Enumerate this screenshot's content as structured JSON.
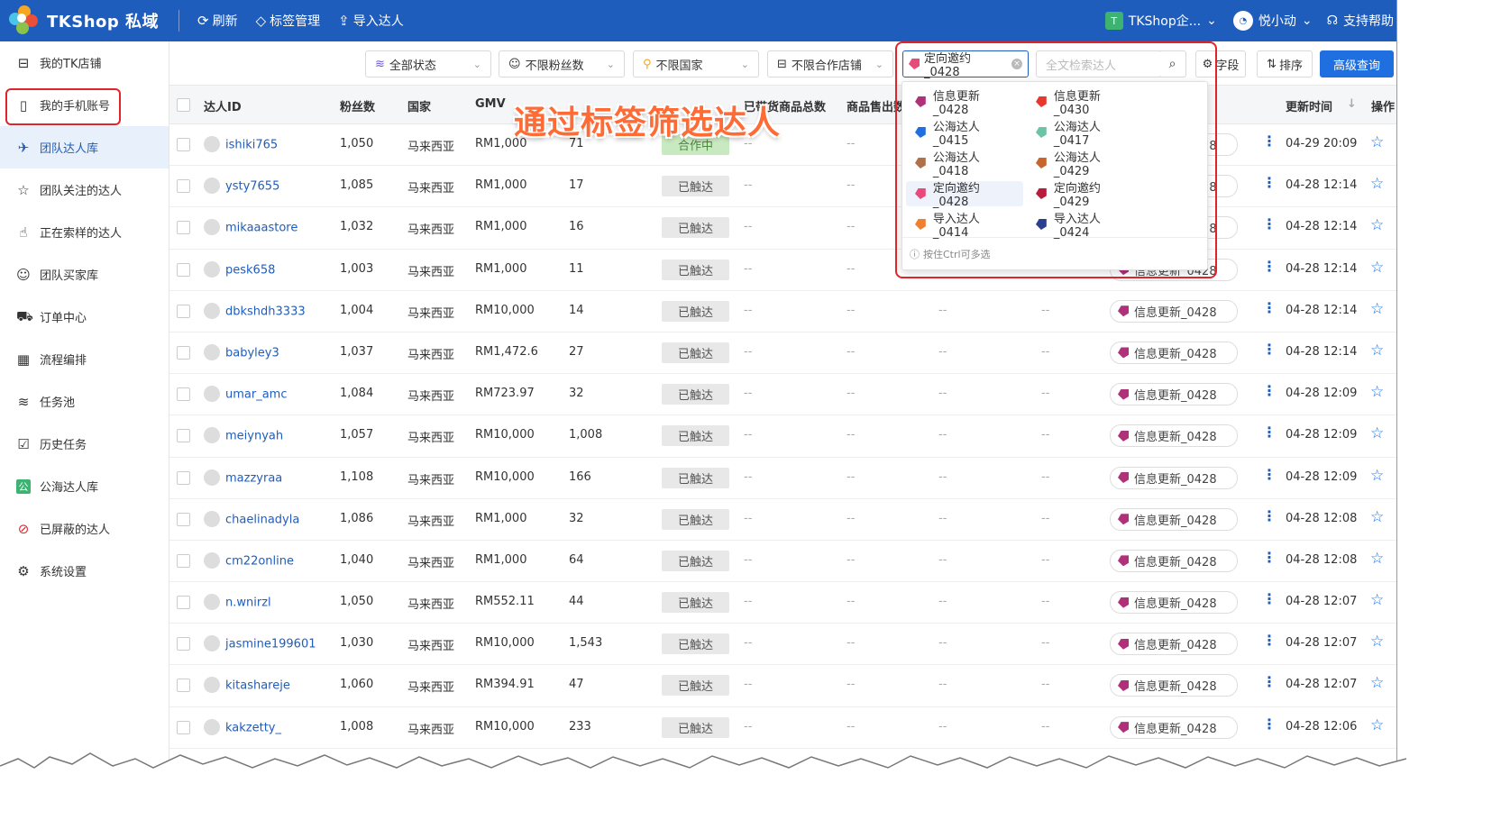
{
  "header": {
    "app_title": "TKShop 私域",
    "refresh": "刷新",
    "tag_manage": "标签管理",
    "import": "导入达人",
    "shop_badge": "T",
    "shop_name": "TKShop企...",
    "user_name": "悦小动",
    "support": "支持帮助"
  },
  "sidebar": {
    "items": [
      {
        "label": "我的TK店铺",
        "icon": "shop-icon"
      },
      {
        "label": "我的手机账号",
        "icon": "phone-icon"
      },
      {
        "label": "团队达人库",
        "icon": "creator-icon"
      },
      {
        "label": "团队关注的达人",
        "icon": "star-outline-icon"
      },
      {
        "label": "正在索样的达人",
        "icon": "hand-icon"
      },
      {
        "label": "团队买家库",
        "icon": "buyers-icon"
      },
      {
        "label": "订单中心",
        "icon": "truck-icon"
      },
      {
        "label": "流程编排",
        "icon": "calendar-icon"
      },
      {
        "label": "任务池",
        "icon": "layers-icon"
      },
      {
        "label": "历史任务",
        "icon": "clipboard-icon"
      },
      {
        "label": "公海达人库",
        "icon": "public-icon"
      },
      {
        "label": "已屏蔽的达人",
        "icon": "block-icon"
      },
      {
        "label": "系统设置",
        "icon": "gear-icon"
      }
    ]
  },
  "filters": {
    "status": "全部状态",
    "fans": "不限粉丝数",
    "country": "不限国家",
    "shops": "不限合作店铺",
    "tag": "定向邀约_0428",
    "search_placeholder": "全文检索达人",
    "fields": "字段",
    "sort": "排序",
    "advanced": "高级查询"
  },
  "table": {
    "headers": {
      "id": "达人ID",
      "fans": "粉丝数",
      "country": "国家",
      "gmv": "GMV",
      "goods_total": "已带货商品总数",
      "goods_sales": "商品售出数",
      "updated": "更新时间",
      "ops": "操作"
    },
    "rows": [
      {
        "id": "ishiki765",
        "fans": "1,050",
        "country": "马来西亚",
        "gmv": "RM1,000",
        "count": "71",
        "status": "合作中",
        "tag": "信息更新_0428",
        "time": "04-29 20:09"
      },
      {
        "id": "ysty7655",
        "fans": "1,085",
        "country": "马来西亚",
        "gmv": "RM1,000",
        "count": "17",
        "status": "已触达",
        "tag": "信息更新_0428",
        "time": "04-28 12:14"
      },
      {
        "id": "mikaaastore",
        "fans": "1,032",
        "country": "马来西亚",
        "gmv": "RM1,000",
        "count": "16",
        "status": "已触达",
        "tag": "信息更新_0428",
        "time": "04-28 12:14"
      },
      {
        "id": "pesk658",
        "fans": "1,003",
        "country": "马来西亚",
        "gmv": "RM1,000",
        "count": "11",
        "status": "已触达",
        "tag": "信息更新_0428",
        "time": "04-28 12:14"
      },
      {
        "id": "dbkshdh3333",
        "fans": "1,004",
        "country": "马来西亚",
        "gmv": "RM10,000",
        "count": "14",
        "status": "已触达",
        "tag": "信息更新_0428",
        "time": "04-28 12:14"
      },
      {
        "id": "babyley3",
        "fans": "1,037",
        "country": "马来西亚",
        "gmv": "RM1,472.6",
        "count": "27",
        "status": "已触达",
        "tag": "信息更新_0428",
        "time": "04-28 12:14"
      },
      {
        "id": "umar_amc",
        "fans": "1,084",
        "country": "马来西亚",
        "gmv": "RM723.97",
        "count": "32",
        "status": "已触达",
        "tag": "信息更新_0428",
        "time": "04-28 12:09"
      },
      {
        "id": "meiynyah",
        "fans": "1,057",
        "country": "马来西亚",
        "gmv": "RM10,000",
        "count": "1,008",
        "status": "已触达",
        "tag": "信息更新_0428",
        "time": "04-28 12:09"
      },
      {
        "id": "mazzyraa",
        "fans": "1,108",
        "country": "马来西亚",
        "gmv": "RM10,000",
        "count": "166",
        "status": "已触达",
        "tag": "信息更新_0428",
        "time": "04-28 12:09"
      },
      {
        "id": "chaelinadyla",
        "fans": "1,086",
        "country": "马来西亚",
        "gmv": "RM1,000",
        "count": "32",
        "status": "已触达",
        "tag": "信息更新_0428",
        "time": "04-28 12:08"
      },
      {
        "id": "cm22online",
        "fans": "1,040",
        "country": "马来西亚",
        "gmv": "RM1,000",
        "count": "64",
        "status": "已触达",
        "tag": "信息更新_0428",
        "time": "04-28 12:08"
      },
      {
        "id": "n.wnirzl",
        "fans": "1,050",
        "country": "马来西亚",
        "gmv": "RM552.11",
        "count": "44",
        "status": "已触达",
        "tag": "信息更新_0428",
        "time": "04-28 12:07"
      },
      {
        "id": "jasmine199601",
        "fans": "1,030",
        "country": "马来西亚",
        "gmv": "RM10,000",
        "count": "1,543",
        "status": "已触达",
        "tag": "信息更新_0428",
        "time": "04-28 12:07"
      },
      {
        "id": "kitashareje",
        "fans": "1,060",
        "country": "马来西亚",
        "gmv": "RM394.91",
        "count": "47",
        "status": "已触达",
        "tag": "信息更新_0428",
        "time": "04-28 12:07"
      },
      {
        "id": "kakzetty_",
        "fans": "1,008",
        "country": "马来西亚",
        "gmv": "RM10,000",
        "count": "233",
        "status": "已触达",
        "tag": "信息更新_0428",
        "time": "04-28 12:06"
      }
    ],
    "dash": "--",
    "partial_digit": "8"
  },
  "dropdown": {
    "items": [
      {
        "label": "信息更新_0428",
        "color": "#b0307a"
      },
      {
        "label": "信息更新_0430",
        "color": "#e8382e"
      },
      {
        "label": "公海达人_0415",
        "color": "#1f6fe0"
      },
      {
        "label": "公海达人_0417",
        "color": "#6cc3a5"
      },
      {
        "label": "公海达人_0418",
        "color": "#b0714a"
      },
      {
        "label": "公海达人_0429",
        "color": "#c8652f"
      },
      {
        "label": "定向邀约_0428",
        "color": "#e84a7a"
      },
      {
        "label": "定向邀约_0429",
        "color": "#b81c3c"
      },
      {
        "label": "导入达人_0414",
        "color": "#f08030"
      },
      {
        "label": "导入达人_0424",
        "color": "#2b3f8f"
      }
    ],
    "footer": "按住Ctrl可多选"
  },
  "annotation": "通过标签筛选达人",
  "colors": {
    "brand": "#1f5dbd",
    "primary_button": "#1f6fe0",
    "highlight_box": "#e0242b",
    "annotation_text": "#ff6b35",
    "tag_color": "#b0307a"
  }
}
